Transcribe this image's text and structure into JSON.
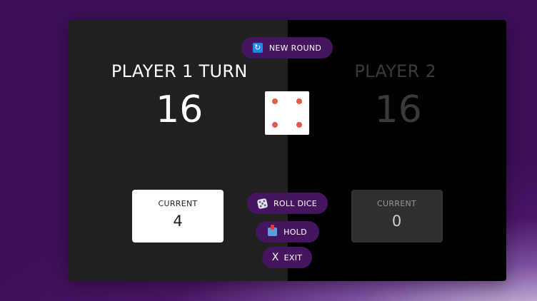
{
  "player1": {
    "name": "PLAYER 1 TURN",
    "score": "16",
    "current_label": "CURRENT",
    "current_value": "4",
    "active": true
  },
  "player2": {
    "name": "PLAYER 2",
    "score": "16",
    "current_label": "CURRENT",
    "current_value": "0",
    "active": false
  },
  "buttons": {
    "new_round": {
      "label": "NEW ROUND",
      "icon": "refresh-icon"
    },
    "roll_dice": {
      "label": "ROLL DICE",
      "icon": "dice-icon"
    },
    "hold": {
      "label": "HOLD",
      "icon": "inbox-tray-icon"
    },
    "exit": {
      "label": "EXIT",
      "icon_text": "X"
    }
  },
  "dice": {
    "value": 4,
    "pip_color": "#e25a4f"
  },
  "colors": {
    "accent": "#46155f",
    "background": "#3c0f58",
    "active_panel": "#202020",
    "inactive_panel": "#000000"
  }
}
